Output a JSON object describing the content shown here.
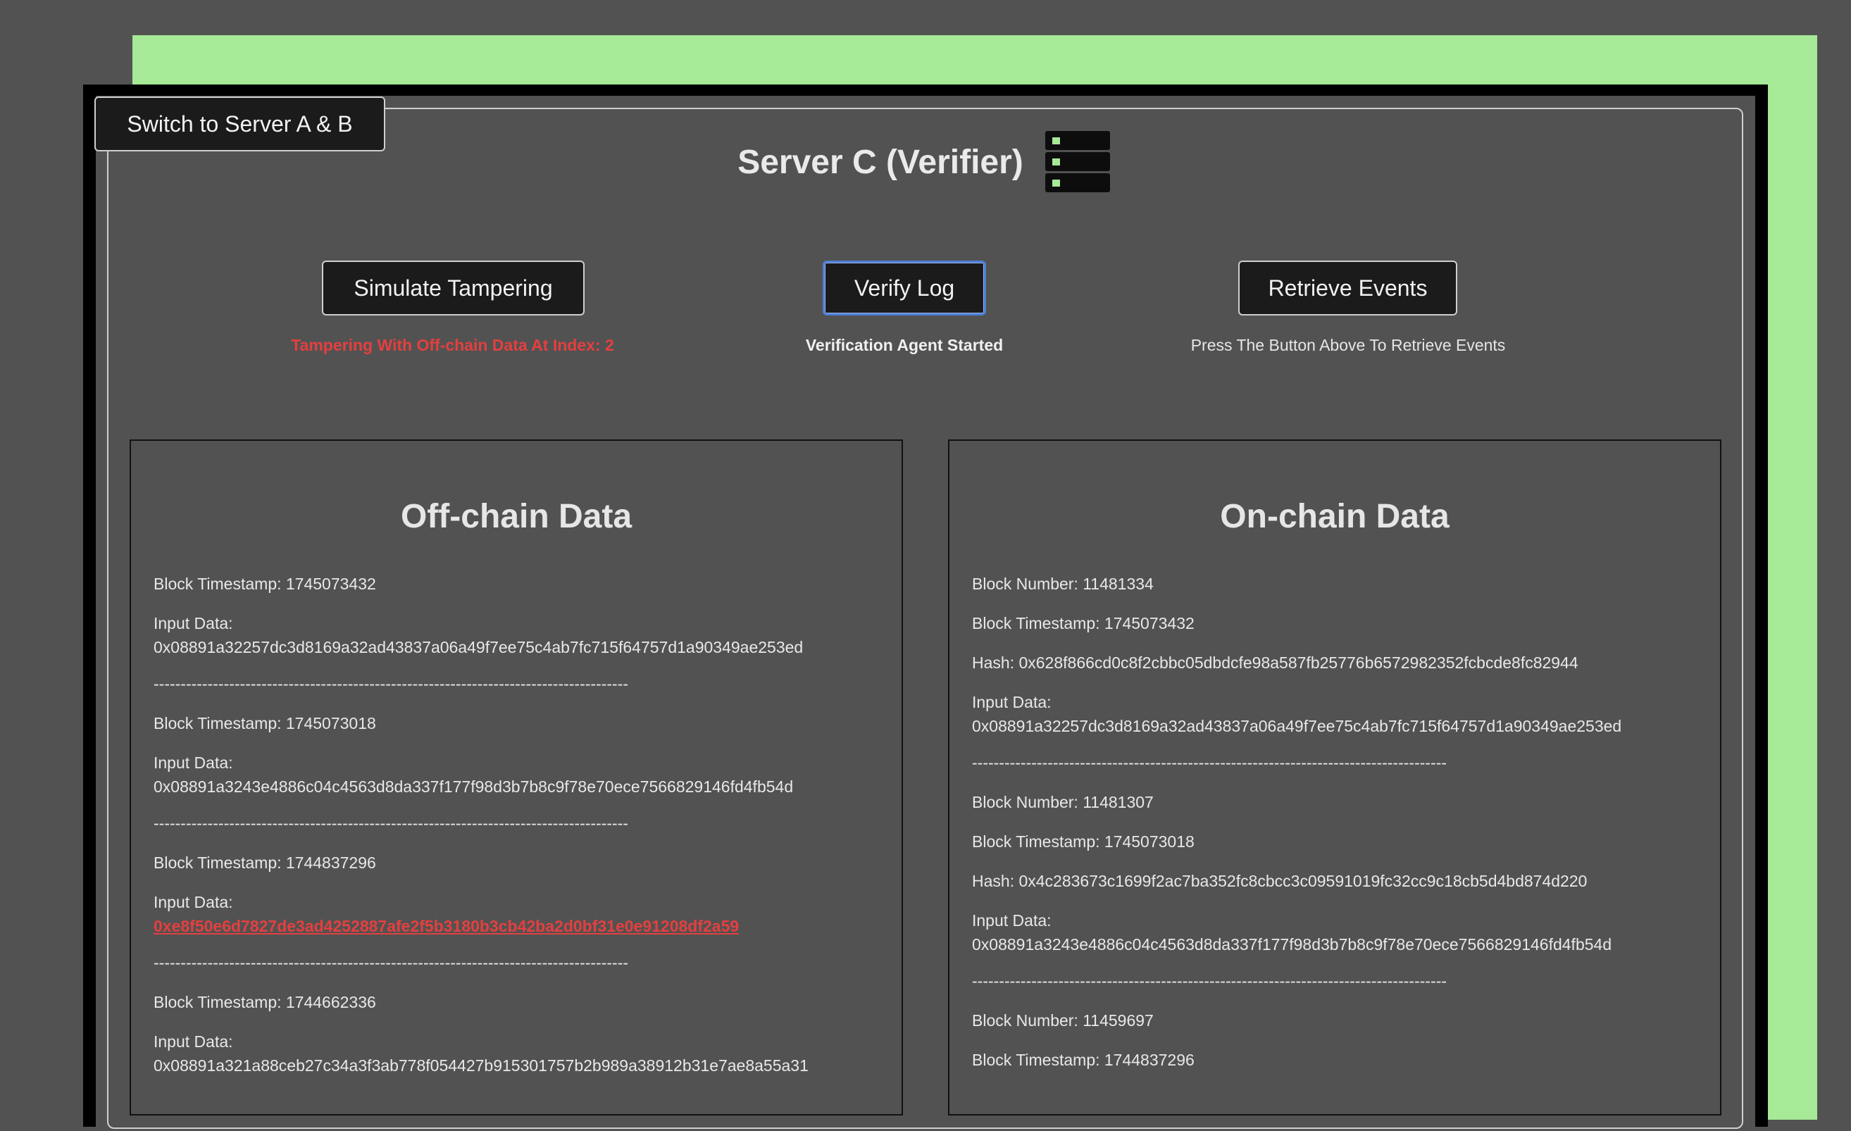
{
  "header": {
    "switch_label": "Switch to Server A & B",
    "title": "Server C (Verifier)",
    "server_icon": "server-rack-icon"
  },
  "actions": {
    "simulate_label": "Simulate Tampering",
    "verify_label": "Verify Log",
    "retrieve_label": "Retrieve Events",
    "simulate_status": "Tampering With Off-chain Data At Index: 2",
    "verify_status": "Verification Agent Started",
    "retrieve_status": "Press The Button Above To Retrieve Events"
  },
  "colors": {
    "accent_green": "#a6e996",
    "tamper_red": "#e53f3f",
    "focus_blue": "#4d7fd6"
  },
  "offchain": {
    "title": "Off-chain Data",
    "separator": "----------------------------------------------------------------------------------------",
    "entries": [
      {
        "timestamp": "Block Timestamp: 1745073432",
        "input_label": "Input Data:",
        "input": "0x08891a32257dc3d8169a32ad43837a06a49f7ee75c4ab7fc715f64757d1a90349ae253ed"
      },
      {
        "timestamp": "Block Timestamp: 1745073018",
        "input_label": "Input Data:",
        "input": "0x08891a3243e4886c04c4563d8da337f177f98d3b7b8c9f78e70ece7566829146fd4fb54d"
      },
      {
        "timestamp": "Block Timestamp: 1744837296",
        "input_label": "Input Data:",
        "input": "0xe8f50e6d7827de3ad4252887afe2f5b3180b3cb42ba2d0bf31e0e91208df2a59"
      },
      {
        "timestamp": "Block Timestamp: 1744662336",
        "input_label": "Input Data:",
        "input": "0x08891a321a88ceb27c34a3f3ab778f054427b915301757b2b989a38912b31e7ae8a55a31"
      }
    ]
  },
  "onchain": {
    "title": "On-chain Data",
    "separator": "----------------------------------------------------------------------------------------",
    "entries": [
      {
        "block_number": "Block Number: 11481334",
        "timestamp": "Block Timestamp: 1745073432",
        "hash": "Hash: 0x628f866cd0c8f2cbbc05dbdcfe98a587fb25776b6572982352fcbcde8fc82944",
        "input_label": "Input Data:",
        "input": "0x08891a32257dc3d8169a32ad43837a06a49f7ee75c4ab7fc715f64757d1a90349ae253ed"
      },
      {
        "block_number": "Block Number: 11481307",
        "timestamp": "Block Timestamp: 1745073018",
        "hash": "Hash: 0x4c283673c1699f2ac7ba352fc8cbcc3c09591019fc32cc9c18cb5d4bd874d220",
        "input_label": "Input Data:",
        "input": "0x08891a3243e4886c04c4563d8da337f177f98d3b7b8c9f78e70ece7566829146fd4fb54d"
      },
      {
        "block_number": "Block Number: 11459697",
        "timestamp": "Block Timestamp: 1744837296"
      }
    ]
  }
}
